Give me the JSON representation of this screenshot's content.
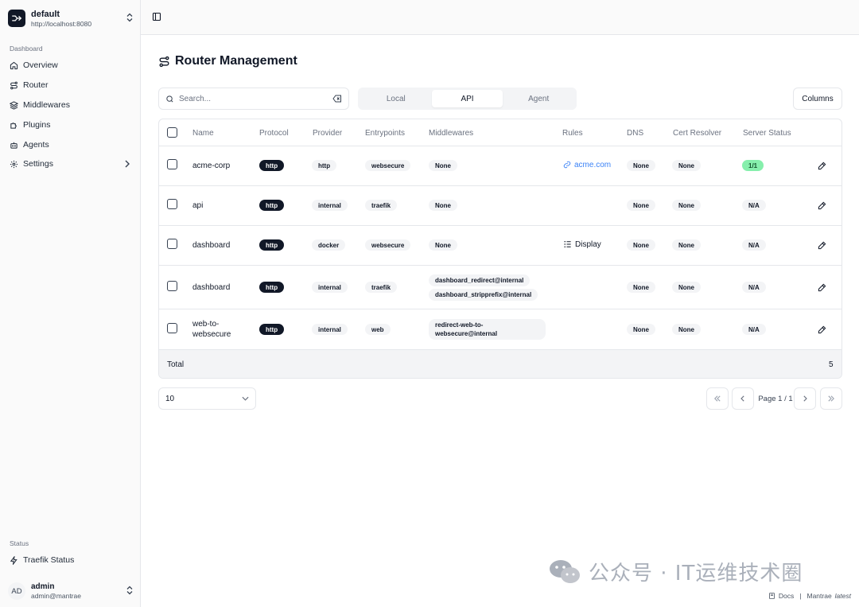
{
  "workspace": {
    "name": "default",
    "url": "http://localhost:8080"
  },
  "sidebar": {
    "dashboard_label": "Dashboard",
    "items": [
      {
        "label": "Overview",
        "icon": "home-icon"
      },
      {
        "label": "Router",
        "icon": "route-icon"
      },
      {
        "label": "Middlewares",
        "icon": "layers-icon"
      },
      {
        "label": "Plugins",
        "icon": "puzzle-icon"
      },
      {
        "label": "Agents",
        "icon": "bot-icon"
      },
      {
        "label": "Settings",
        "icon": "gear-icon"
      }
    ],
    "status_label": "Status",
    "status_items": [
      {
        "label": "Traefik Status",
        "icon": "zap-icon"
      }
    ],
    "user": {
      "initials": "AD",
      "name": "admin",
      "email": "admin@mantrae"
    }
  },
  "main": {
    "title": "Router Management",
    "search_placeholder": "Search...",
    "tabs": [
      {
        "label": "Local",
        "active": false
      },
      {
        "label": "API",
        "active": true
      },
      {
        "label": "Agent",
        "active": false
      }
    ],
    "columns_label": "Columns",
    "table": {
      "headers": [
        "Name",
        "Protocol",
        "Provider",
        "Entrypoints",
        "Middlewares",
        "Rules",
        "DNS",
        "Cert Resolver",
        "Server Status"
      ],
      "rows": [
        {
          "name": "acme-corp",
          "protocol": "http",
          "provider": "http",
          "entrypoints": "websecure",
          "middlewares": [
            "None"
          ],
          "rule": "acme.com",
          "rule_type": "link",
          "dns": "None",
          "cert": "None",
          "status": "1/1"
        },
        {
          "name": "api",
          "protocol": "http",
          "provider": "internal",
          "entrypoints": "traefik",
          "middlewares": [
            "None"
          ],
          "rule": "",
          "rule_type": "none",
          "dns": "None",
          "cert": "None",
          "status": "N/A"
        },
        {
          "name": "dashboard",
          "protocol": "http",
          "provider": "docker",
          "entrypoints": "websecure",
          "middlewares": [
            "None"
          ],
          "rule": "Display",
          "rule_type": "display",
          "dns": "None",
          "cert": "None",
          "status": "N/A"
        },
        {
          "name": "dashboard",
          "protocol": "http",
          "provider": "internal",
          "entrypoints": "traefik",
          "middlewares": [
            "dashboard_redirect@internal",
            "dashboard_stripprefix@internal"
          ],
          "rule": "",
          "rule_type": "none",
          "dns": "None",
          "cert": "None",
          "status": "N/A"
        },
        {
          "name": "web-to-\nwebsecure",
          "protocol": "http",
          "provider": "internal",
          "entrypoints": "web",
          "middlewares": [
            "redirect-web-to-\nwebsecure@internal"
          ],
          "rule": "",
          "rule_type": "none",
          "dns": "None",
          "cert": "None",
          "status": "N/A"
        }
      ],
      "footer_label": "Total",
      "footer_value": "5"
    },
    "pagination": {
      "page_size": "10",
      "page_label": "Page 1 / 1"
    }
  },
  "watermark": "公众号 · IT运维技术圈",
  "bottom": {
    "docs": "Docs",
    "brand": "Mantrae",
    "version": "latest"
  },
  "colors": {
    "accent_link": "#3b82f6",
    "status_ok": "#86efac",
    "badge_dark": "#111827"
  }
}
